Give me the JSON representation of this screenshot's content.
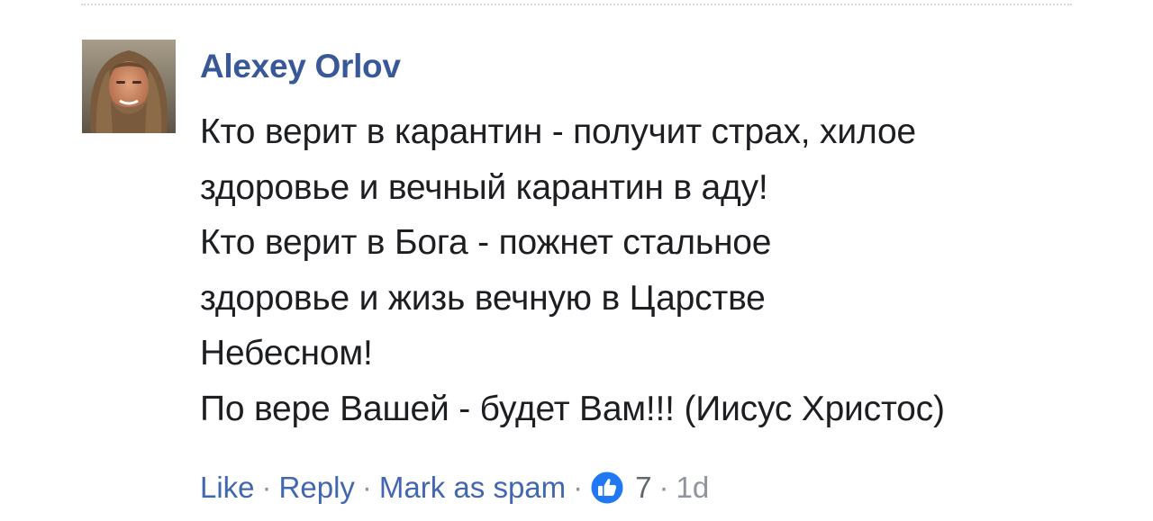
{
  "comment": {
    "author": "Alexey Orlov",
    "lines": [
      "Кто верит в карантин - получит страх, хилое",
      "здоровье и вечный карантин в аду!",
      "Кто верит в Бога - пожнет стальное",
      "здоровье и жизь вечную в Царстве",
      "Небесном!",
      "По вере Вашей - будет Вам!!! (Иисус Христос)"
    ]
  },
  "actions": {
    "like_label": "Like",
    "reply_label": "Reply",
    "spam_label": "Mark as spam",
    "separator": "·",
    "reaction_icon": "like-thumb-icon",
    "reaction_count": "7",
    "timestamp": "1d"
  },
  "colors": {
    "author_link": "#385898",
    "action_link": "#4267b2",
    "meta_gray": "#90949c",
    "like_badge": "#2078f4",
    "text": "#1c1e21"
  }
}
